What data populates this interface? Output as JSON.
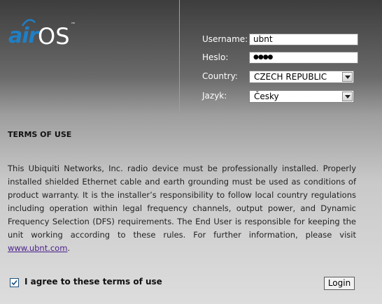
{
  "logo": {
    "brand_prefix": "air",
    "brand_suffix": "OS",
    "trademark": "™"
  },
  "login_form": {
    "username": {
      "label": "Username:",
      "value": "ubnt"
    },
    "password": {
      "label": "Heslo:",
      "value": "●●●●"
    },
    "country": {
      "label": "Country:",
      "value": "CZECH REPUBLIC"
    },
    "language": {
      "label": "Jazyk:",
      "value": "Česky"
    }
  },
  "terms": {
    "title": "TERMS OF USE",
    "body": "This Ubiquiti Networks, Inc. radio device must be professionally installed. Properly installed shielded Ethernet cable and earth grounding must be used as conditions of product warranty. It is the installer’s responsibility to follow local country regulations including operation within legal frequency channels, output power, and Dynamic Frequency Selection (DFS) requirements. The End User is responsible for keeping the unit working according to these rules. For further information, please visit ",
    "link": "www.ubnt.com",
    "body_end": "."
  },
  "agree": {
    "label": "I agree to these terms of use",
    "checked": true
  },
  "login_button": "Login",
  "colors": {
    "brand_blue": "#1f7fc6",
    "divider": "#8aa2c0",
    "link": "#4a1f8c"
  }
}
